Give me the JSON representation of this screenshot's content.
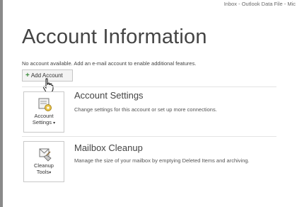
{
  "window": {
    "title": "Inbox - Outlook Data File - Mic"
  },
  "page": {
    "title": "Account Information",
    "info_text": "No account available. Add an e-mail account to enable additional features."
  },
  "add_account": {
    "label": "Add Account",
    "icon": "plus-icon"
  },
  "sections": {
    "account_settings": {
      "tile_line1": "Account",
      "tile_line2": "Settings",
      "title": "Account Settings",
      "description": "Change settings for this account or set up more connections.",
      "icon": "account-settings-icon"
    },
    "mailbox_cleanup": {
      "tile_line1": "Cleanup",
      "tile_line2": "Tools",
      "title": "Mailbox Cleanup",
      "description": "Manage the size of your mailbox by emptying Deleted Items and archiving.",
      "icon": "cleanup-tools-icon"
    }
  }
}
